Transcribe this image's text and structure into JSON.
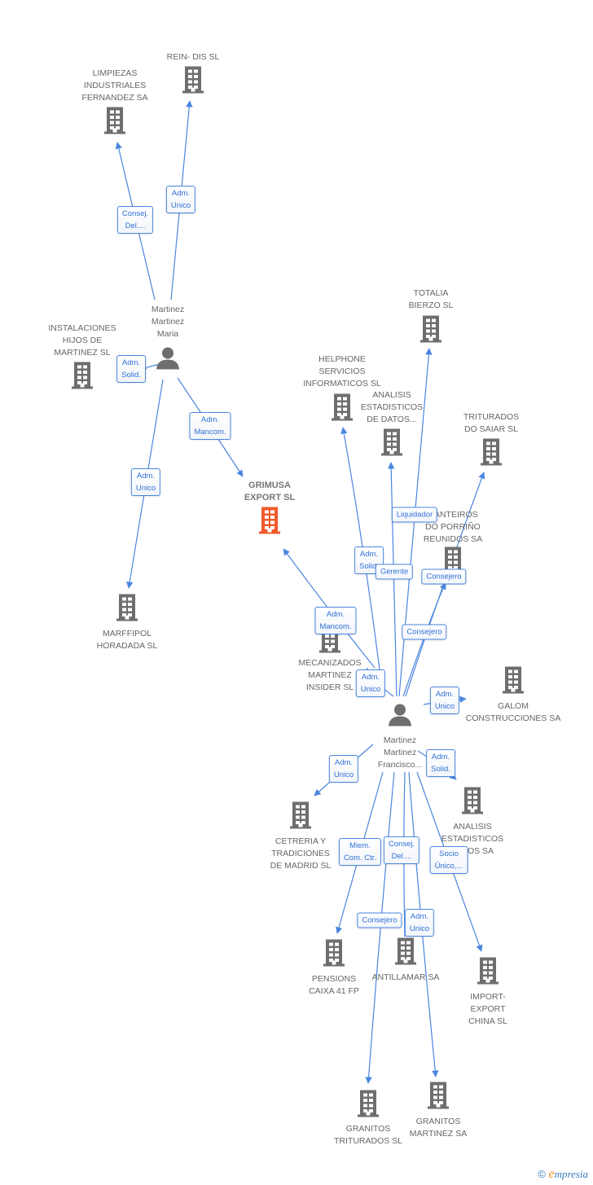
{
  "colors": {
    "edge": "#4a86e0",
    "building": "#6e6e6e",
    "main_building": "#f05a2a",
    "label_text": "#2f6fd6"
  },
  "nodes": [
    {
      "id": "reindis",
      "type": "company",
      "lines": [
        "REIN- DIS SL"
      ]
    },
    {
      "id": "limpiezas",
      "type": "company",
      "lines": [
        "LIMPIEZAS",
        "INDUSTRIALES",
        "FERNANDEZ SA"
      ]
    },
    {
      "id": "maria",
      "type": "person",
      "lines": [
        "Martinez",
        "Martinez",
        "Maria"
      ]
    },
    {
      "id": "instalaciones",
      "type": "company",
      "lines": [
        "INSTALACIONES",
        "HIJOS DE",
        "MARTINEZ SL"
      ]
    },
    {
      "id": "marffipol",
      "type": "company",
      "lines": [
        "MARFFIPOL",
        "HORADADA SL"
      ]
    },
    {
      "id": "grimusa",
      "type": "main",
      "lines": [
        "GRIMUSA",
        "EXPORT SL"
      ]
    },
    {
      "id": "helphone",
      "type": "company",
      "lines": [
        "HELPHONE",
        "SERVICIOS",
        "INFORMATICOS SL"
      ]
    },
    {
      "id": "totalia",
      "type": "company",
      "lines": [
        "TOTALIA",
        "BIERZO SL"
      ]
    },
    {
      "id": "analisis_datos",
      "type": "company",
      "lines": [
        "ANALISIS",
        "ESTADISTICOS",
        "DE DATOS..."
      ]
    },
    {
      "id": "triturados_saiar",
      "type": "company",
      "lines": [
        "TRITURADOS",
        "DO SAIAR SL"
      ]
    },
    {
      "id": "canteiros",
      "type": "company",
      "lines": [
        "CANTEIROS",
        "DO PORRIÑO",
        "REUNIDOS SA"
      ]
    },
    {
      "id": "mecanizados",
      "type": "company",
      "lines": [
        "MECANIZADOS",
        "MARTINEZ",
        "INSIDER SL"
      ]
    },
    {
      "id": "galom",
      "type": "company",
      "lines": [
        "GALOM",
        "CONSTRUCCIONES SA"
      ]
    },
    {
      "id": "francisco",
      "type": "person",
      "lines": [
        "Martinez",
        "Martinez",
        "Francisco..."
      ]
    },
    {
      "id": "cetreria",
      "type": "company",
      "lines": [
        "CETRERIA Y",
        "TRADICIONES",
        "DE MADRID SL"
      ]
    },
    {
      "id": "analisis_sa",
      "type": "company",
      "lines": [
        "ANALISIS",
        "ESTADISTICOS",
        "DATOS SA"
      ]
    },
    {
      "id": "pensions",
      "type": "company",
      "lines": [
        "PENSIONS",
        "CAIXA 41 FP"
      ]
    },
    {
      "id": "antillamar",
      "type": "company",
      "lines": [
        "ANTILLAMAR SA"
      ]
    },
    {
      "id": "import_export",
      "type": "company",
      "lines": [
        "IMPORT-",
        "EXPORT",
        "CHINA SL"
      ]
    },
    {
      "id": "granitos_triturados",
      "type": "company",
      "lines": [
        "GRANITOS",
        "TRITURADOS SL"
      ]
    },
    {
      "id": "granitos_martinez",
      "type": "company",
      "lines": [
        "GRANITOS",
        "MARTINEZ SA"
      ]
    }
  ],
  "edges": [
    {
      "from": "maria",
      "to": "limpiezas",
      "lines": [
        "Consej.",
        "Del...."
      ]
    },
    {
      "from": "maria",
      "to": "reindis",
      "lines": [
        "Adm.",
        "Unico"
      ]
    },
    {
      "from": "maria",
      "to": "instalaciones",
      "lines": [
        "Adm.",
        "Solid."
      ]
    },
    {
      "from": "maria",
      "to": "grimusa",
      "lines": [
        "Adm.",
        "Mancom."
      ]
    },
    {
      "from": "maria",
      "to": "marffipol",
      "lines": [
        "Adm.",
        "Unico"
      ]
    },
    {
      "from": "francisco",
      "to": "grimusa",
      "lines": [
        "Adm.",
        "Mancom."
      ]
    },
    {
      "from": "francisco",
      "to": "helphone",
      "lines": [
        "Adm.",
        "Solid."
      ]
    },
    {
      "from": "francisco",
      "to": "analisis_datos",
      "lines": [
        "Gerente"
      ]
    },
    {
      "from": "francisco",
      "to": "totalia",
      "lines": [
        "Liquidador"
      ]
    },
    {
      "from": "francisco",
      "to": "canteiros",
      "lines": [
        "Consejero"
      ]
    },
    {
      "from": "francisco",
      "to": "triturados_saiar",
      "lines": [
        "Consejero"
      ]
    },
    {
      "from": "francisco",
      "to": "mecanizados",
      "lines": [
        "Adm.",
        "Unico"
      ]
    },
    {
      "from": "francisco",
      "to": "galom",
      "lines": [
        "Adm.",
        "Unico"
      ]
    },
    {
      "from": "francisco",
      "to": "cetreria",
      "lines": [
        "Adm.",
        "Unico"
      ]
    },
    {
      "from": "francisco",
      "to": "analisis_sa",
      "lines": [
        "Adm.",
        "Solid."
      ]
    },
    {
      "from": "francisco",
      "to": "pensions",
      "lines": [
        "Miem.",
        "Com. Ctr."
      ]
    },
    {
      "from": "francisco",
      "to": "antillamar",
      "lines": [
        "Consej.",
        "Del...."
      ]
    },
    {
      "from": "francisco",
      "to": "granitos_triturados",
      "lines": [
        "Consejero"
      ]
    },
    {
      "from": "francisco",
      "to": "granitos_martinez",
      "lines": [
        "Adm.",
        "Unico"
      ]
    },
    {
      "from": "francisco",
      "to": "import_export",
      "lines": [
        "Socio",
        "Único,..."
      ]
    }
  ],
  "footer": {
    "copyright": "©",
    "brand_first": "e",
    "brand_rest": "mpresia"
  }
}
